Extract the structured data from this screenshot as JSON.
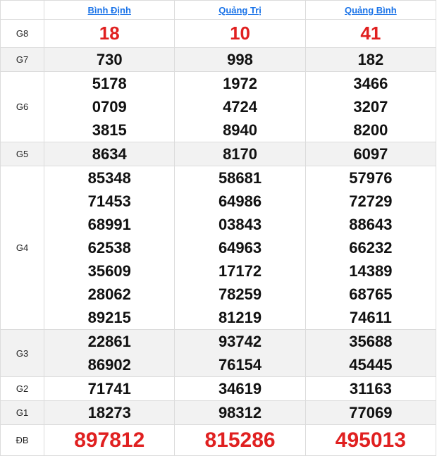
{
  "provinces": [
    "Bình Định",
    "Quảng Trị",
    "Quảng Bình"
  ],
  "prizes": [
    {
      "label": "G8",
      "values": [
        [
          "18"
        ],
        [
          "10"
        ],
        [
          "41"
        ]
      ]
    },
    {
      "label": "G7",
      "values": [
        [
          "730"
        ],
        [
          "998"
        ],
        [
          "182"
        ]
      ]
    },
    {
      "label": "G6",
      "values": [
        [
          "5178",
          "0709",
          "3815"
        ],
        [
          "1972",
          "4724",
          "8940"
        ],
        [
          "3466",
          "3207",
          "8200"
        ]
      ]
    },
    {
      "label": "G5",
      "values": [
        [
          "8634"
        ],
        [
          "8170"
        ],
        [
          "6097"
        ]
      ]
    },
    {
      "label": "G4",
      "values": [
        [
          "85348",
          "71453",
          "68991",
          "62538",
          "35609",
          "28062",
          "89215"
        ],
        [
          "58681",
          "64986",
          "03843",
          "64963",
          "17172",
          "78259",
          "81219"
        ],
        [
          "57976",
          "72729",
          "88643",
          "66232",
          "14389",
          "68765",
          "74611"
        ]
      ]
    },
    {
      "label": "G3",
      "values": [
        [
          "22861",
          "86902"
        ],
        [
          "93742",
          "76154"
        ],
        [
          "35688",
          "45445"
        ]
      ]
    },
    {
      "label": "G2",
      "values": [
        [
          "71741"
        ],
        [
          "34619"
        ],
        [
          "31163"
        ]
      ]
    },
    {
      "label": "G1",
      "values": [
        [
          "18273"
        ],
        [
          "98312"
        ],
        [
          "77069"
        ]
      ]
    },
    {
      "label": "ĐB",
      "values": [
        [
          "897812"
        ],
        [
          "815286"
        ],
        [
          "495013"
        ]
      ]
    }
  ],
  "colors": {
    "special": "#e02020",
    "link": "#1a73e8",
    "shade": "#f2f2f2",
    "border": "#dcdcdc"
  }
}
